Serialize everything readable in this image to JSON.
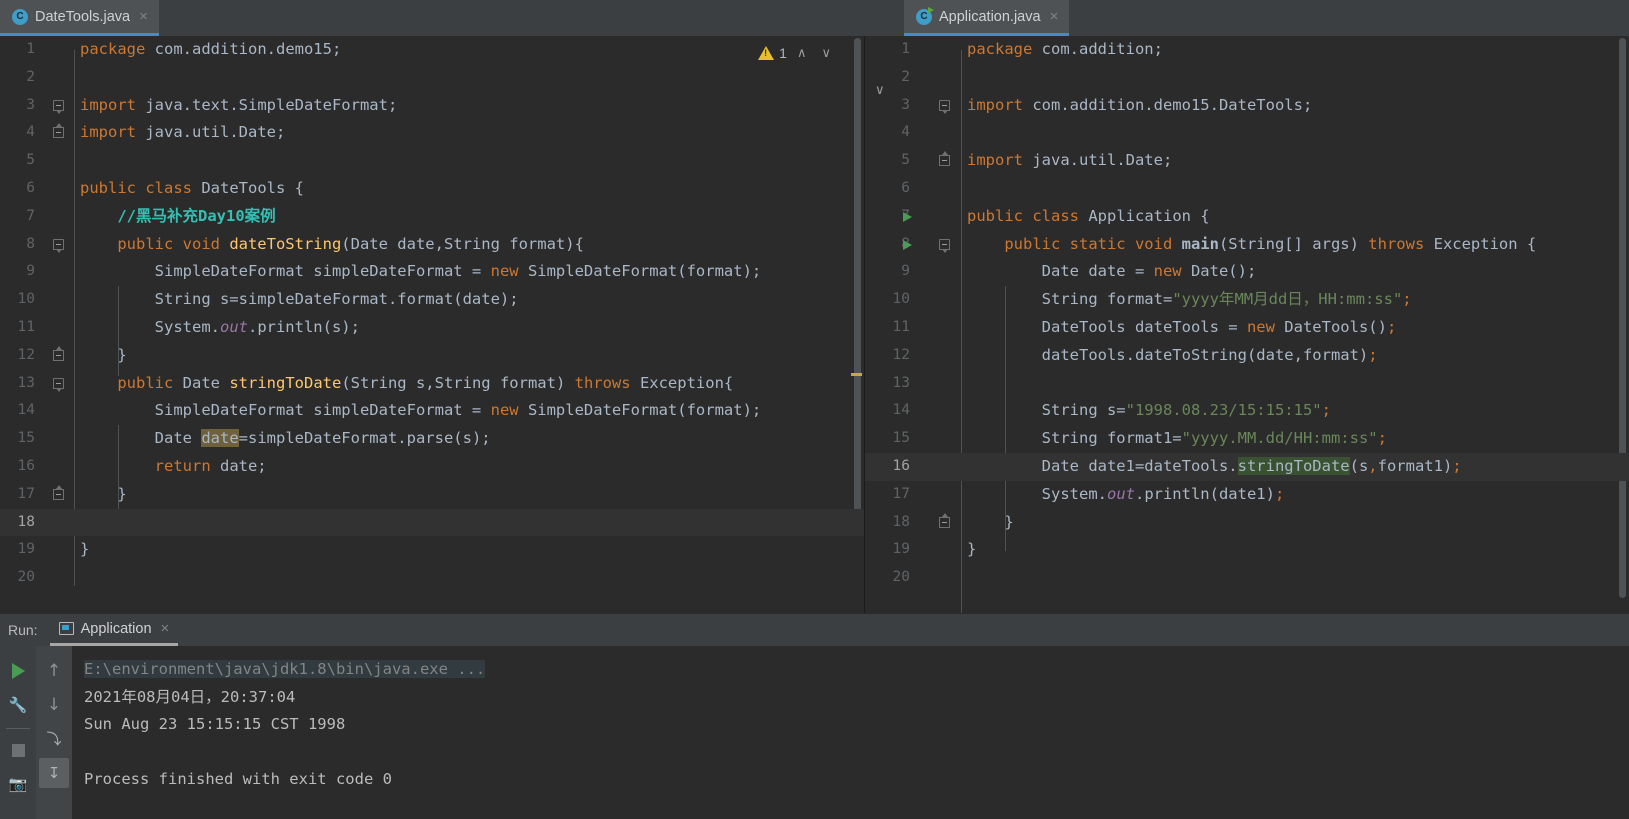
{
  "editors": {
    "left": {
      "tab": {
        "label": "DateTools.java",
        "icon": "java-class-icon",
        "close": "×"
      },
      "inspection": {
        "icon": "warning-triangle-icon",
        "count": "1",
        "prev": "∧",
        "next": "∨"
      },
      "lines": [
        {
          "n": "1",
          "text": "package com.addition.demo15;"
        },
        {
          "n": "2",
          "text": ""
        },
        {
          "n": "3",
          "text": "import java.text.SimpleDateFormat;"
        },
        {
          "n": "4",
          "text": "import java.util.Date;"
        },
        {
          "n": "5",
          "text": ""
        },
        {
          "n": "6",
          "text": "public class DateTools {"
        },
        {
          "n": "7",
          "text": "    //黑马补充Day10案例"
        },
        {
          "n": "8",
          "text": "    public void dateToString(Date date,String format){"
        },
        {
          "n": "9",
          "text": "        SimpleDateFormat simpleDateFormat = new SimpleDateFormat(format);"
        },
        {
          "n": "10",
          "text": "        String s=simpleDateFormat.format(date);"
        },
        {
          "n": "11",
          "text": "        System.out.println(s);"
        },
        {
          "n": "12",
          "text": "    }"
        },
        {
          "n": "13",
          "text": "    public Date stringToDate(String s,String format) throws Exception{"
        },
        {
          "n": "14",
          "text": "        SimpleDateFormat simpleDateFormat = new SimpleDateFormat(format);"
        },
        {
          "n": "15",
          "text": "        Date date=simpleDateFormat.parse(s);"
        },
        {
          "n": "16",
          "text": "        return date;"
        },
        {
          "n": "17",
          "text": "    }"
        },
        {
          "n": "18",
          "text": ""
        },
        {
          "n": "19",
          "text": "}"
        },
        {
          "n": "20",
          "text": ""
        }
      ]
    },
    "right": {
      "tab": {
        "label": "Application.java",
        "icon": "java-runnable-class-icon",
        "close": "×"
      },
      "collapse": "∨",
      "lines": [
        {
          "n": "1",
          "text": "package com.addition;"
        },
        {
          "n": "2",
          "text": ""
        },
        {
          "n": "3",
          "text": "import com.addition.demo15.DateTools;"
        },
        {
          "n": "4",
          "text": ""
        },
        {
          "n": "5",
          "text": "import java.util.Date;"
        },
        {
          "n": "6",
          "text": ""
        },
        {
          "n": "7",
          "text": "public class Application {"
        },
        {
          "n": "8",
          "text": "    public static void main(String[] args) throws Exception {"
        },
        {
          "n": "9",
          "text": "        Date date = new Date();"
        },
        {
          "n": "10",
          "text": "        String format=\"yyyy年MM月dd日，HH:mm:ss\";"
        },
        {
          "n": "11",
          "text": "        DateTools dateTools = new DateTools();"
        },
        {
          "n": "12",
          "text": "        dateTools.dateToString(date,format);"
        },
        {
          "n": "13",
          "text": ""
        },
        {
          "n": "14",
          "text": "        String s=\"1998.08.23/15:15:15\";"
        },
        {
          "n": "15",
          "text": "        String format1=\"yyyy.MM.dd/HH:mm:ss\";"
        },
        {
          "n": "16",
          "text": "        Date date1=dateTools.stringToDate(s,format1);"
        },
        {
          "n": "17",
          "text": "        System.out.println(date1);"
        },
        {
          "n": "18",
          "text": "    }"
        },
        {
          "n": "19",
          "text": "}"
        },
        {
          "n": "20",
          "text": ""
        }
      ]
    }
  },
  "run_panel": {
    "label": "Run:",
    "tab": {
      "label": "Application",
      "icon": "run-configuration-icon",
      "close": "×"
    },
    "toolbar_left": [
      {
        "name": "rerun-button",
        "icon": "play-icon"
      },
      {
        "name": "edit-configuration-button",
        "icon": "wrench-icon"
      },
      {
        "name": "stop-button",
        "icon": "stop-icon"
      },
      {
        "name": "screenshot-button",
        "icon": "camera-icon"
      }
    ],
    "toolbar_right": [
      {
        "name": "up-button",
        "icon": "arrow-up-icon",
        "glyph": "↑"
      },
      {
        "name": "down-button",
        "icon": "arrow-down-icon",
        "glyph": "↓"
      },
      {
        "name": "soft-wrap-button",
        "icon": "soft-wrap-icon",
        "glyph": "⤵"
      },
      {
        "name": "scroll-to-end-button",
        "icon": "scroll-to-end-icon",
        "glyph": "↧"
      }
    ],
    "console": [
      {
        "text": "E:\\environment\\java\\jdk1.8\\bin\\java.exe ...",
        "kind": "cmd"
      },
      {
        "text": "2021年08月04日，20:37:04",
        "kind": "out"
      },
      {
        "text": "Sun Aug 23 15:15:15 CST 1998",
        "kind": "out"
      },
      {
        "text": "",
        "kind": "out"
      },
      {
        "text": "Process finished with exit code 0",
        "kind": "out"
      }
    ]
  },
  "colors": {
    "background": "#2b2b2b",
    "chrome": "#3c3f41",
    "keyword": "#cc7832",
    "method": "#ffc66d",
    "string": "#6a8759",
    "comment": "#33c0b3",
    "tab_underline": "#4a88c7",
    "run_green": "#499c54",
    "warning": "#e8bf30"
  }
}
